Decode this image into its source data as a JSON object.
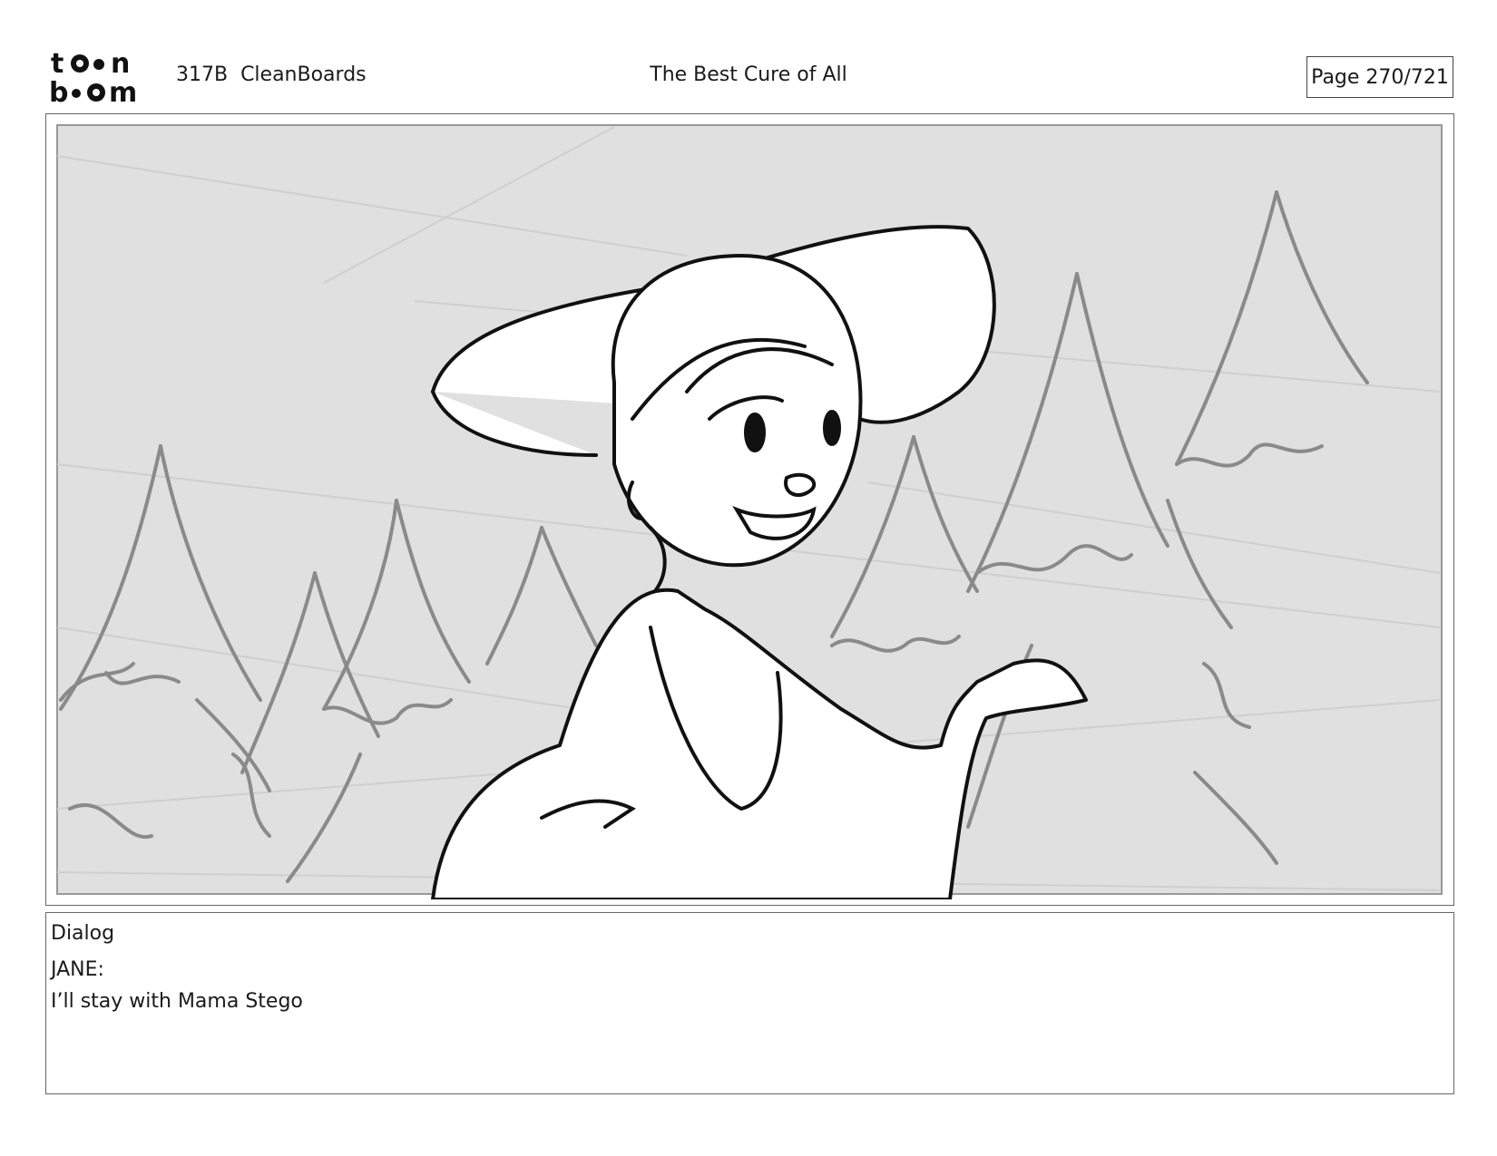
{
  "header": {
    "logo_text": "toon boom",
    "doc_id": "317B  CleanBoards",
    "title": "The Best Cure of All",
    "page": "Page 270/721"
  },
  "panel": {
    "image_description_icon": "storyboard-sketch"
  },
  "dialog": {
    "label": "Dialog",
    "speaker": "JANE:",
    "line": "I’ll stay with Mama Stego"
  }
}
